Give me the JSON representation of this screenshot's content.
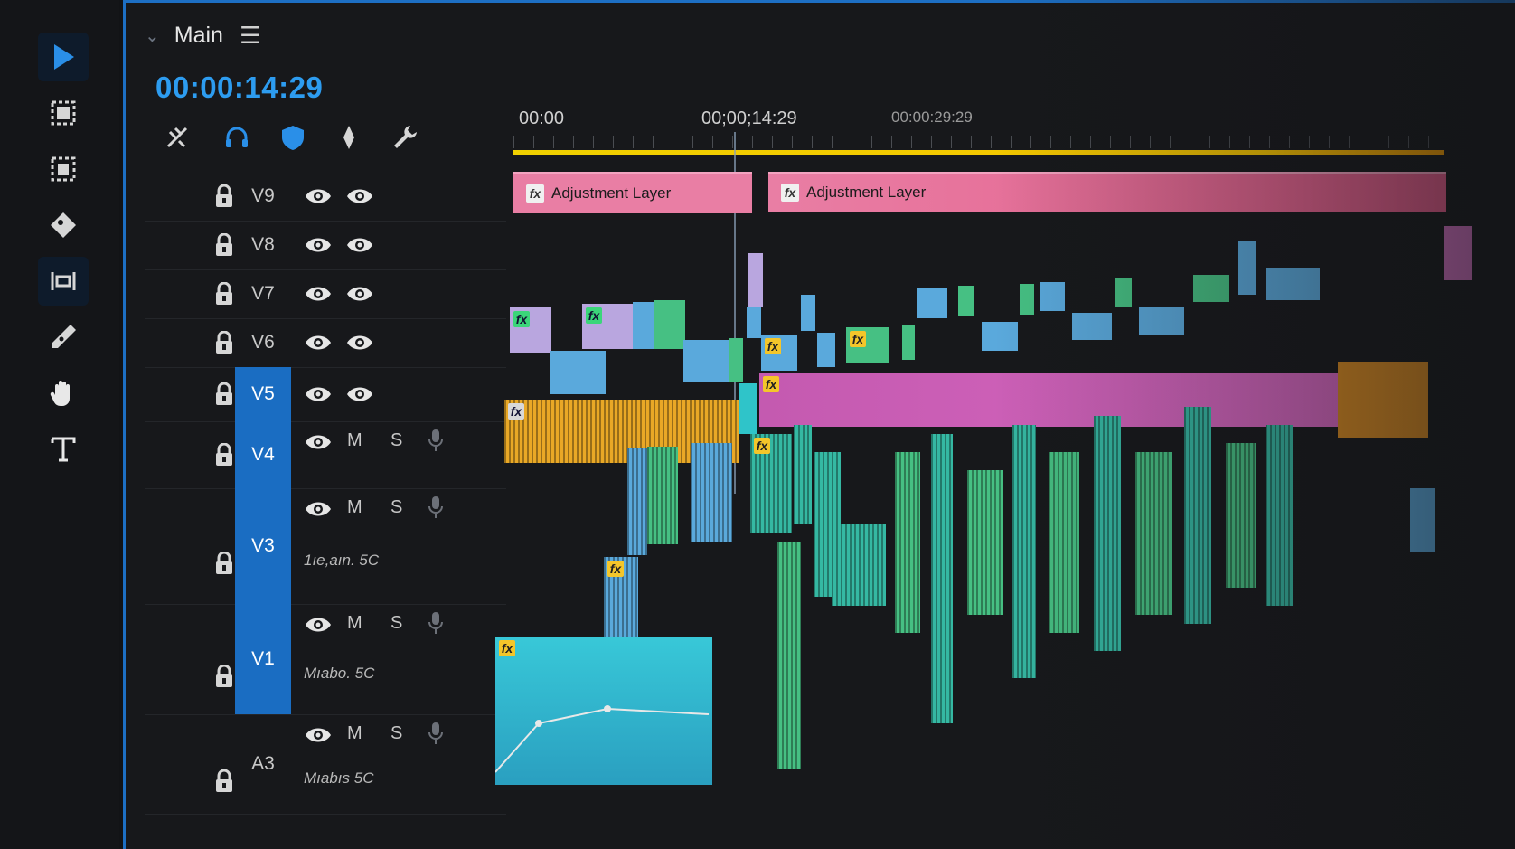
{
  "sequence": {
    "tab_label": "Main",
    "timecode": "00:00:14:29"
  },
  "tools": [
    "selection-tool",
    "track-select-forward-tool",
    "track-select-backward-tool",
    "ripple-edit-tool",
    "slip-tool",
    "pen-tool",
    "hand-tool",
    "type-tool"
  ],
  "header_icons": [
    "snap-icon",
    "linked-selection-icon",
    "shield-icon",
    "add-marker-icon",
    "wrench-icon"
  ],
  "ruler": {
    "labels": [
      "00:00",
      "00;00;14:29",
      "00:00:29:29"
    ]
  },
  "tracks": [
    {
      "name": "V9",
      "selected": false,
      "controls": "eyes"
    },
    {
      "name": "V8",
      "selected": false,
      "controls": "eyes"
    },
    {
      "name": "V7",
      "selected": false,
      "controls": "eyes"
    },
    {
      "name": "V6",
      "selected": false,
      "controls": "eyes"
    },
    {
      "name": "V5",
      "selected": true,
      "controls": "eyes"
    },
    {
      "name": "V4",
      "selected": true,
      "controls": "audio"
    },
    {
      "name": "V3",
      "selected": true,
      "controls": "audio",
      "clip_name": "1ıe,aın. 5C"
    },
    {
      "name": "V1",
      "selected": true,
      "controls": "audio",
      "clip_name": "Mıabo. 5C"
    },
    {
      "name": "A3",
      "selected": false,
      "controls": "audio",
      "clip_name": "Mıabıs 5C"
    }
  ],
  "audio_controls": {
    "mute": "M",
    "solo": "S"
  },
  "clips": {
    "adjustment_label": "Adjustment Layer",
    "fx_label": "fx"
  },
  "colors": {
    "accent": "#2d9cf0",
    "selected_track": "#1a6dc2",
    "adjustment": "#e97ea4",
    "audio_gold": "#e9a826",
    "audio_pink": "#c45ab0",
    "clip_teal": "#2fc4c9",
    "clip_green": "#46c083",
    "clip_blue": "#5aa9dc"
  }
}
